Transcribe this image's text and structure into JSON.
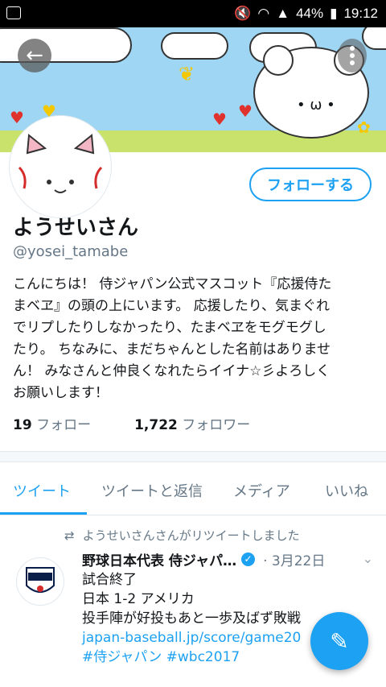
{
  "status_bar": {
    "battery": "44%",
    "time": "19:12"
  },
  "profile": {
    "follow_button": "フォローする",
    "name": "ようせいさん",
    "handle": "@yosei_tamabe",
    "bio_lines": [
      "こんにちは！ 侍ジャパン公式マスコット『応援侍た",
      "まベヱ』の頭の上にいます。 応援したり、気まぐれ",
      "でリプしたりしなかったり、たまベヱをモグモグし",
      "たり。 ちなみに、まだちゃんとした名前はありませ",
      "ん！ みなさんと仲良くなれたらイイナ☆彡よろしく",
      "お願いします！"
    ],
    "following_count": "19",
    "following_label": "フォロー",
    "followers_count": "1,722",
    "followers_label": "フォロワー"
  },
  "tabs": [
    "ツイート",
    "ツイートと返信",
    "メディア",
    "いいね"
  ],
  "tweet": {
    "retweet_notice": "ようせいさんさんがリツイートしました",
    "author": "野球日本代表 侍ジャパ…",
    "date": "· 3月22日",
    "lines": [
      "試合終了",
      "日本 1-2 アメリカ",
      "投手陣が好投もあと一歩及ばず敗戦"
    ],
    "link": "japan-baseball.jp/score/game20",
    "hashtags": "#侍ジャパン #wbc2017"
  },
  "colors": {
    "accent": "#1da1f2",
    "muted": "#657786"
  }
}
